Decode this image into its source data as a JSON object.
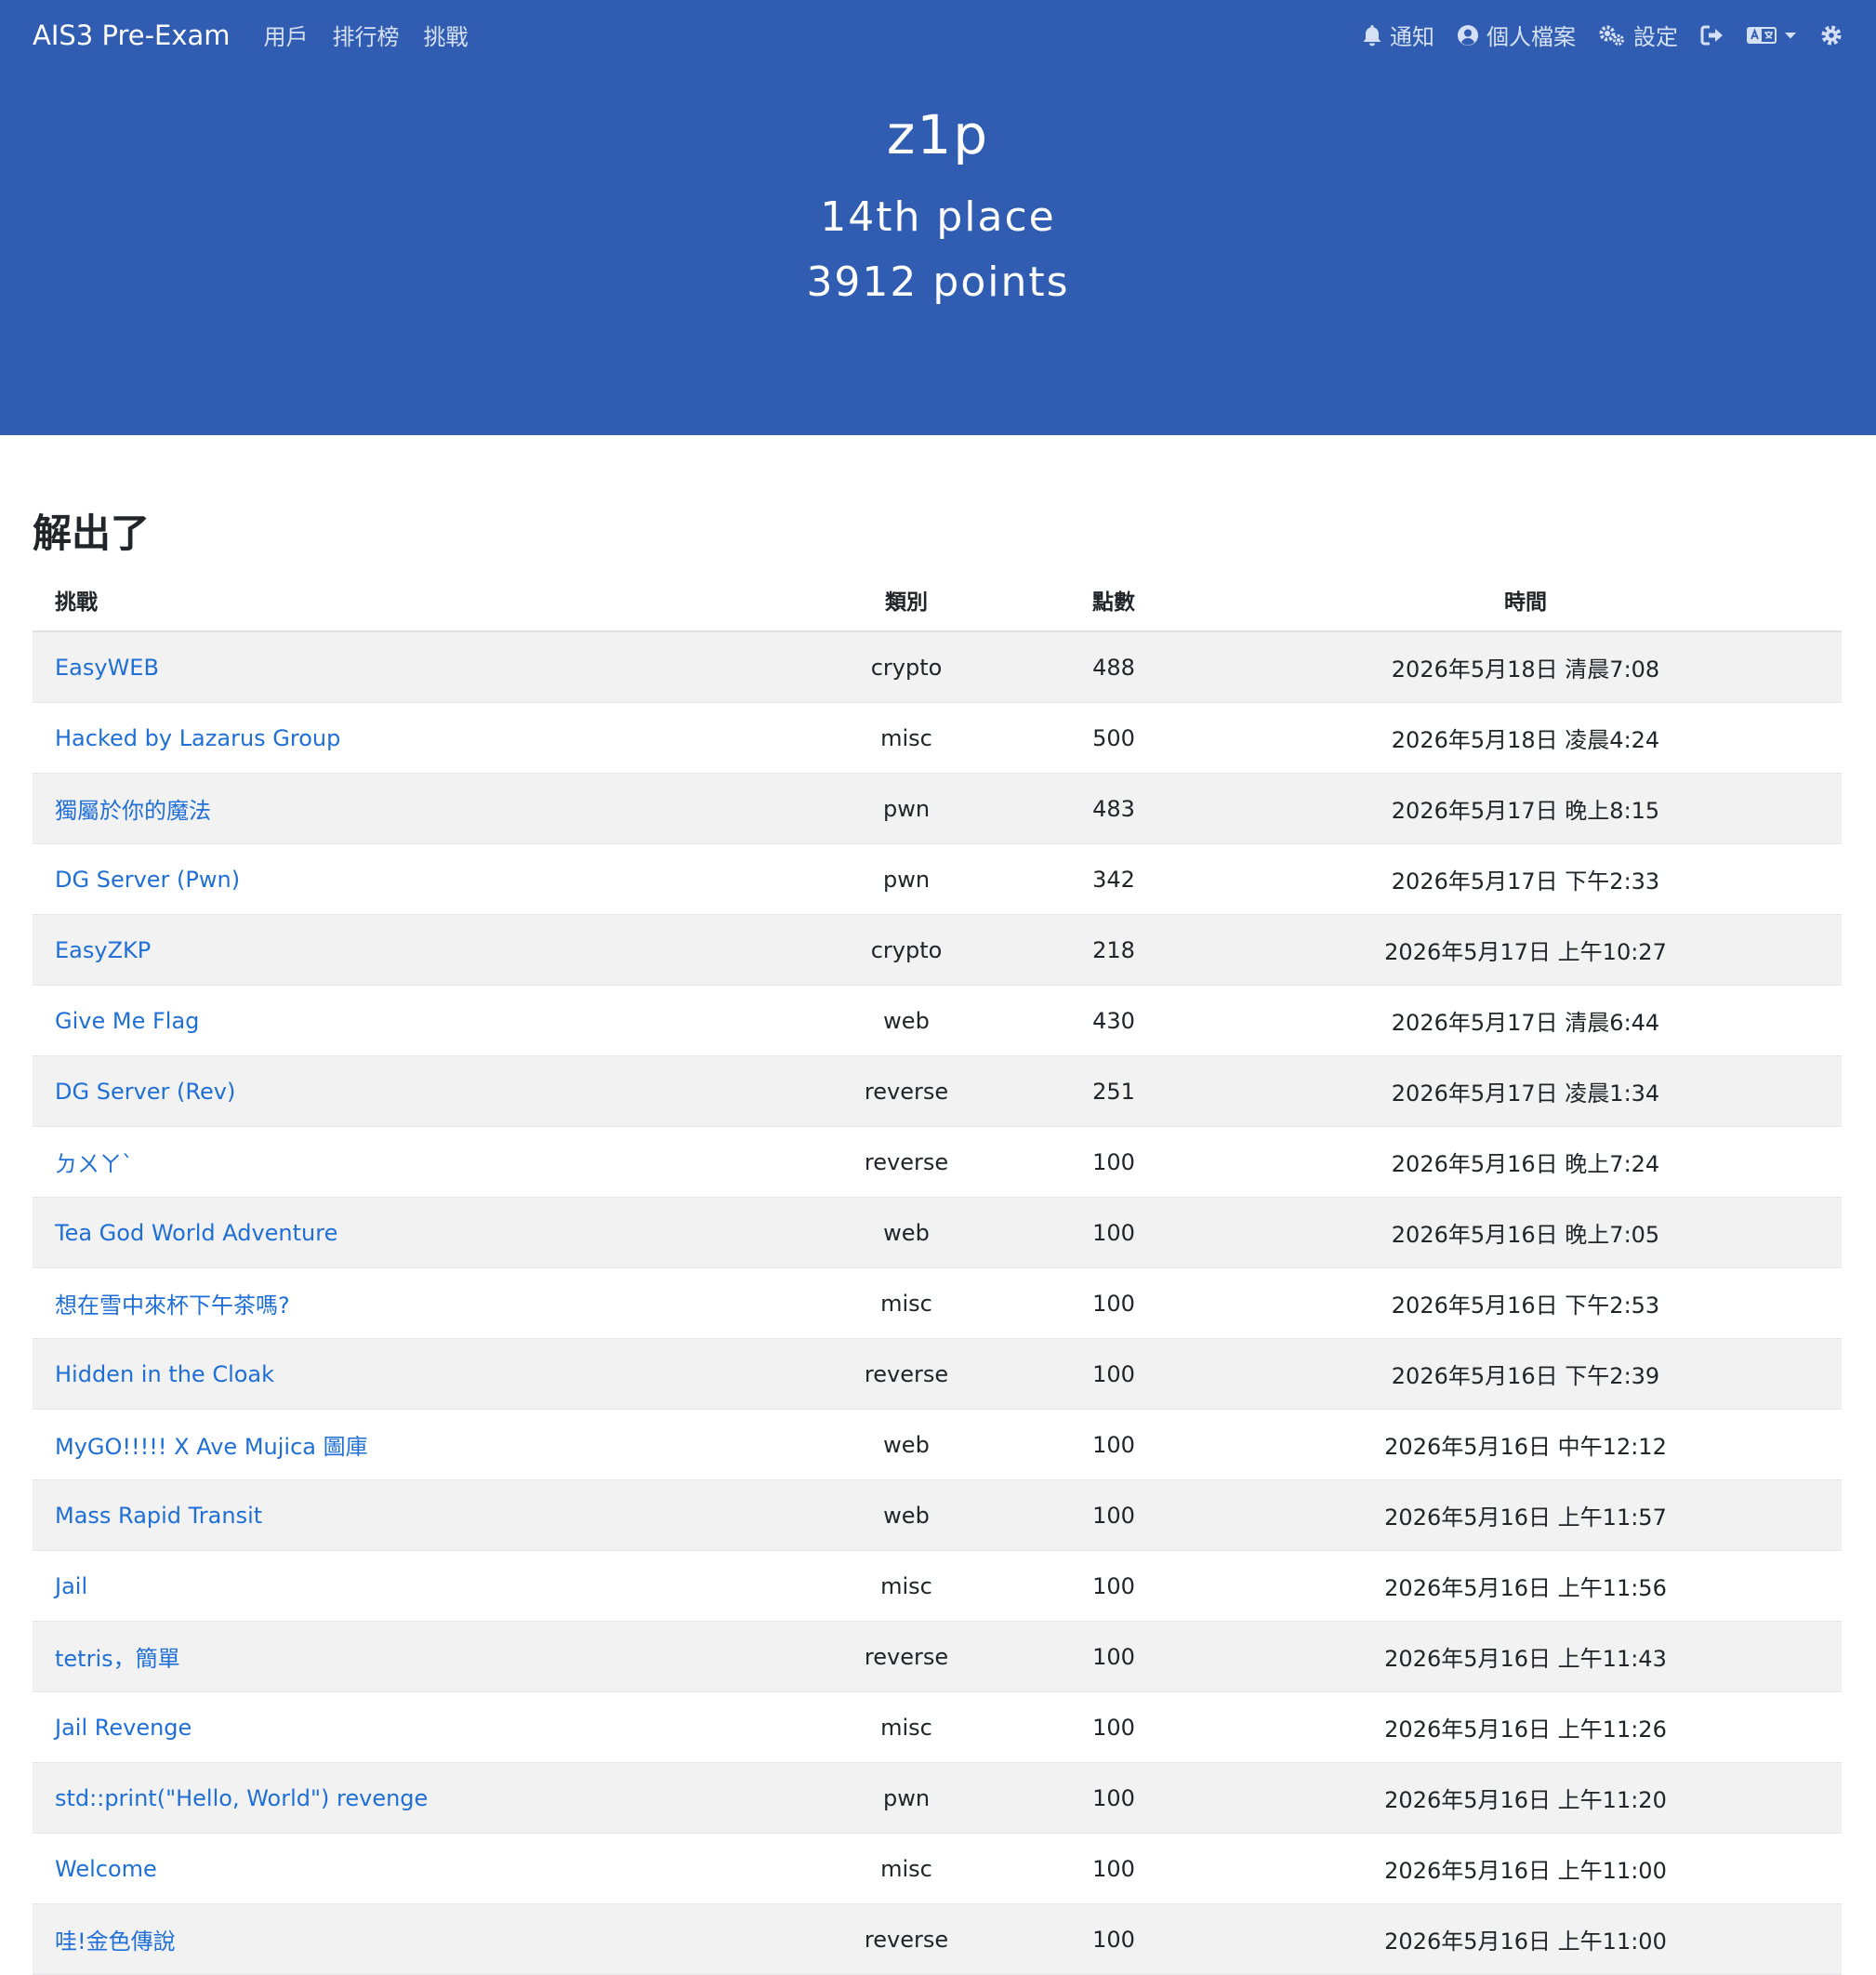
{
  "navbar": {
    "brand": "AIS3 Pre-Exam",
    "links": [
      "用戶",
      "排行榜",
      "挑戰"
    ],
    "notifications": "通知",
    "profile": "個人檔案",
    "settings": "設定"
  },
  "hero": {
    "name": "z1p",
    "place": "14th place",
    "points": "3912 points"
  },
  "solves": {
    "title": "解出了",
    "headers": [
      "挑戰",
      "類別",
      "點數",
      "時間"
    ],
    "rows": [
      {
        "challenge": "EasyWEB",
        "category": "crypto",
        "points": "488",
        "time": "2026年5月18日 清晨7:08"
      },
      {
        "challenge": "Hacked by Lazarus Group",
        "category": "misc",
        "points": "500",
        "time": "2026年5月18日 凌晨4:24"
      },
      {
        "challenge": "獨屬於你的魔法",
        "category": "pwn",
        "points": "483",
        "time": "2026年5月17日 晚上8:15"
      },
      {
        "challenge": "DG Server (Pwn)",
        "category": "pwn",
        "points": "342",
        "time": "2026年5月17日 下午2:33"
      },
      {
        "challenge": "EasyZKP",
        "category": "crypto",
        "points": "218",
        "time": "2026年5月17日 上午10:27"
      },
      {
        "challenge": "Give Me Flag",
        "category": "web",
        "points": "430",
        "time": "2026年5月17日 清晨6:44"
      },
      {
        "challenge": "DG Server (Rev)",
        "category": "reverse",
        "points": "251",
        "time": "2026年5月17日 凌晨1:34"
      },
      {
        "challenge": "ㄉㄨㄚˋ",
        "category": "reverse",
        "points": "100",
        "time": "2026年5月16日 晚上7:24"
      },
      {
        "challenge": "Tea God World Adventure",
        "category": "web",
        "points": "100",
        "time": "2026年5月16日 晚上7:05"
      },
      {
        "challenge": "想在雪中來杯下午茶嗎?",
        "category": "misc",
        "points": "100",
        "time": "2026年5月16日 下午2:53"
      },
      {
        "challenge": "Hidden in the Cloak",
        "category": "reverse",
        "points": "100",
        "time": "2026年5月16日 下午2:39"
      },
      {
        "challenge": "MyGO!!!!! X Ave Mujica 圖庫",
        "category": "web",
        "points": "100",
        "time": "2026年5月16日 中午12:12"
      },
      {
        "challenge": "Mass Rapid Transit",
        "category": "web",
        "points": "100",
        "time": "2026年5月16日 上午11:57"
      },
      {
        "challenge": "Jail",
        "category": "misc",
        "points": "100",
        "time": "2026年5月16日 上午11:56"
      },
      {
        "challenge": "tetris，簡單",
        "category": "reverse",
        "points": "100",
        "time": "2026年5月16日 上午11:43"
      },
      {
        "challenge": "Jail Revenge",
        "category": "misc",
        "points": "100",
        "time": "2026年5月16日 上午11:26"
      },
      {
        "challenge": "std::print(\"Hello, World\") revenge",
        "category": "pwn",
        "points": "100",
        "time": "2026年5月16日 上午11:20"
      },
      {
        "challenge": "Welcome",
        "category": "misc",
        "points": "100",
        "time": "2026年5月16日 上午11:00"
      },
      {
        "challenge": "哇!金色傳說",
        "category": "reverse",
        "points": "100",
        "time": "2026年5月16日 上午11:00"
      }
    ]
  }
}
